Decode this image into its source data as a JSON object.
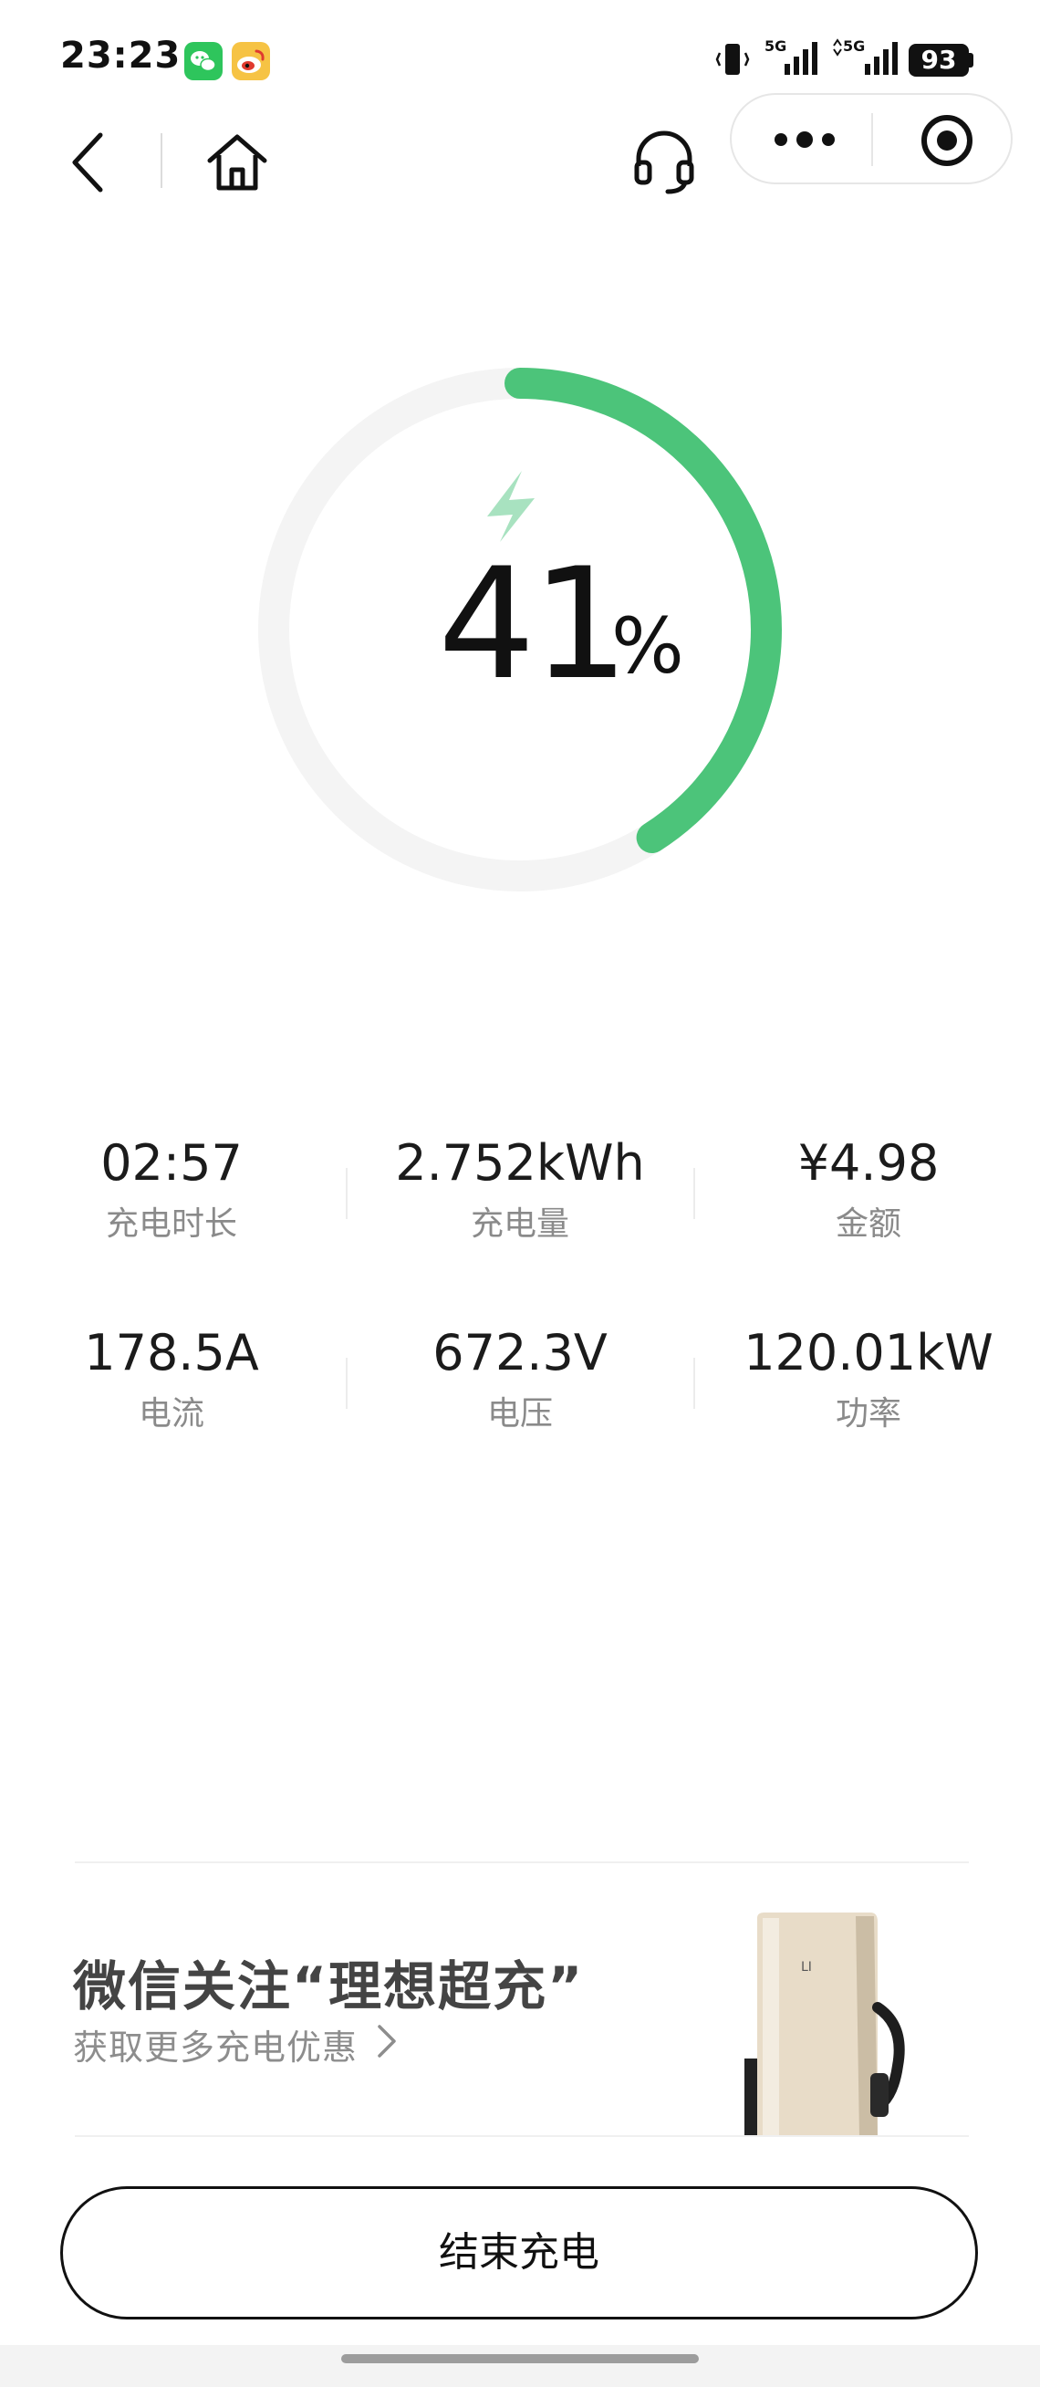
{
  "status_bar": {
    "time": "23:23",
    "battery": "93",
    "network_1": "5G",
    "network_2": "5G"
  },
  "nav": {
    "icons": [
      "back-arrow-icon",
      "home-icon",
      "headset-icon",
      "more-dots-icon",
      "target-icon"
    ]
  },
  "charge": {
    "percent": "41",
    "percent_sign": "%",
    "level": 0.41,
    "colors": {
      "progress": "#4cc47a",
      "track": "#f4f4f4",
      "bolt": "#a8e2c0"
    }
  },
  "stats": [
    {
      "value": "02:57",
      "label": "充电时长"
    },
    {
      "value": "2.752kWh",
      "label": "充电量"
    },
    {
      "value": "¥4.98",
      "label": "金额"
    },
    {
      "value": "178.5A",
      "label": "电流"
    },
    {
      "value": "672.3V",
      "label": "电压"
    },
    {
      "value": "120.01kW",
      "label": "功率"
    }
  ],
  "promo": {
    "title": "微信关注“理想超充”",
    "subtitle": "获取更多充电优惠"
  },
  "actions": {
    "end_charging": "结束充电"
  }
}
